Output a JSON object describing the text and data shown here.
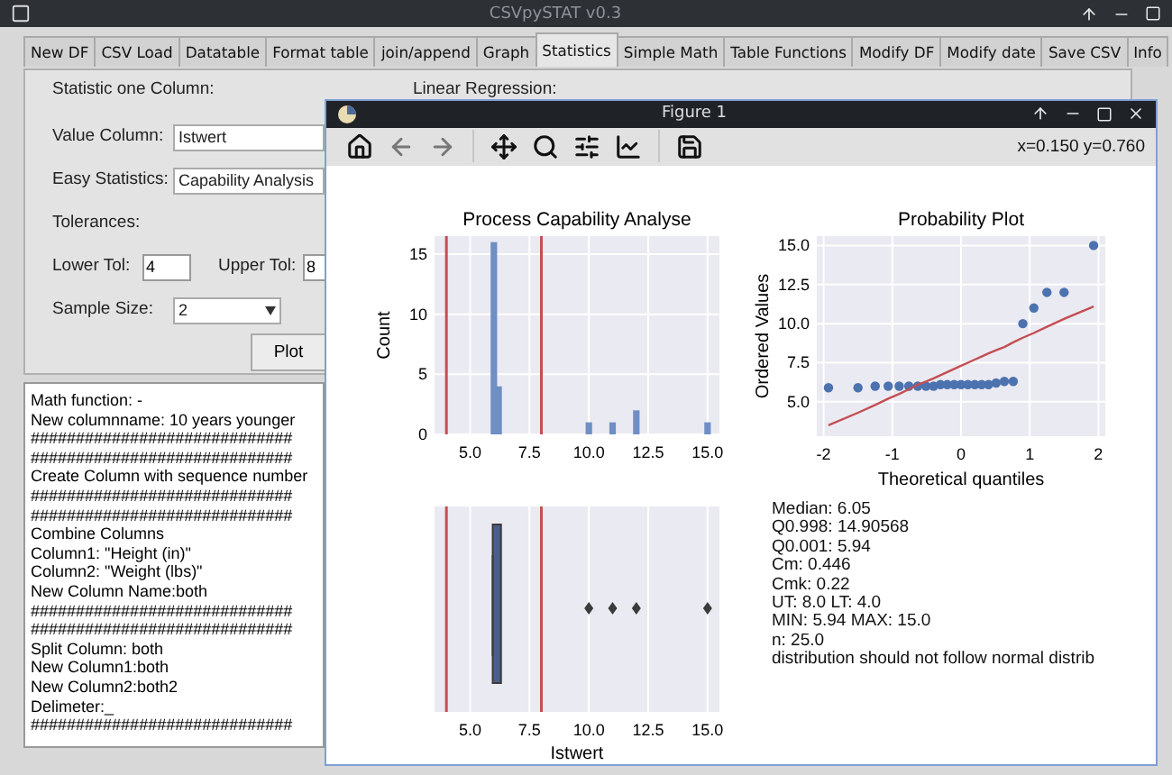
{
  "window": {
    "title": "CSVpySTAT v0.3"
  },
  "tabs": [
    {
      "label": "New DF",
      "selected": false
    },
    {
      "label": "CSV Load",
      "selected": false
    },
    {
      "label": "Datatable",
      "selected": false
    },
    {
      "label": "Format table",
      "selected": false
    },
    {
      "label": "join/append",
      "selected": false
    },
    {
      "label": "Graph",
      "selected": false
    },
    {
      "label": "Statistics",
      "selected": true
    },
    {
      "label": "Simple Math",
      "selected": false
    },
    {
      "label": "Table Functions",
      "selected": false
    },
    {
      "label": "Modify DF",
      "selected": false
    },
    {
      "label": "Modify date",
      "selected": false
    },
    {
      "label": "Save CSV",
      "selected": false
    },
    {
      "label": "Info",
      "selected": false
    }
  ],
  "form": {
    "heading": "Statistic one Column:",
    "regression_heading": "Linear Regression:",
    "value_column": {
      "label": "Value Column:",
      "value": "Istwert"
    },
    "easy_statistics": {
      "label": "Easy Statistics:",
      "value": "Capability Analysis"
    },
    "tolerances_label": "Tolerances:",
    "lower_tol": {
      "label": "Lower Tol:",
      "value": "4"
    },
    "upper_tol": {
      "label": "Upper Tol:",
      "value": "8"
    },
    "sample_size": {
      "label": "Sample Size:",
      "value": "2"
    },
    "plot_button": "Plot"
  },
  "log": {
    "lines": [
      "Math function: -",
      "New columnname: 10 years younger",
      "#############################",
      "#############################",
      "Create Column with sequence number",
      "#############################",
      "#############################",
      "Combine Columns",
      "Column1: \"Height (in)\"",
      "Column2: \"Weight (lbs)\"",
      "New Column Name:both",
      "#############################",
      "#############################",
      "Split Column: both",
      "New Column1:both",
      "New Column2:both2",
      "Delimeter:_",
      "#############################"
    ]
  },
  "figure": {
    "title": "Figure 1",
    "coordinates": "x=0.150 y=0.760",
    "histogram": {
      "title": "Process Capability Analyse",
      "chart_data": {
        "type": "bar",
        "ylabel": "Count",
        "x": [
          6.0,
          6.2,
          10,
          11,
          12,
          15
        ],
        "values": [
          16,
          4,
          1,
          1,
          2,
          1
        ],
        "xlim": [
          3.5,
          15.5
        ],
        "ylim": [
          0,
          16.5
        ],
        "xticks": [
          {
            "value": 5,
            "label": "5.0"
          },
          {
            "value": 7.5,
            "label": "7.5"
          },
          {
            "value": 10,
            "label": "10.0"
          },
          {
            "value": 12.5,
            "label": "12.5"
          },
          {
            "value": 15,
            "label": "15.0"
          }
        ],
        "yticks": [
          0,
          5,
          10,
          15
        ],
        "grid": true,
        "ref_lines": [
          {
            "axis": "x",
            "value": 4
          },
          {
            "axis": "x",
            "value": 8
          }
        ]
      }
    },
    "probability_plot": {
      "title": "Probability Plot",
      "chart_data": {
        "type": "scatter",
        "xlabel": "Theoretical quantiles",
        "ylabel": "Ordered Values",
        "x": [
          -1.93,
          -1.5,
          -1.25,
          -1.06,
          -0.9,
          -0.76,
          -0.63,
          -0.51,
          -0.4,
          -0.3,
          -0.2,
          -0.1,
          0,
          0.1,
          0.2,
          0.3,
          0.4,
          0.51,
          0.63,
          0.76,
          0.9,
          1.06,
          1.25,
          1.5,
          1.93
        ],
        "series": [
          {
            "type": "scatter",
            "color": "#4c72b0",
            "values": [
              5.9,
              5.9,
              6.0,
              6.0,
              6.0,
              6.0,
              6.0,
              6.0,
              6.0,
              6.1,
              6.1,
              6.1,
              6.1,
              6.1,
              6.1,
              6.1,
              6.1,
              6.2,
              6.3,
              6.3,
              10,
              11,
              12,
              12,
              15
            ]
          },
          {
            "type": "line",
            "color": "#c44e52",
            "values": [
              3.5,
              4.3,
              4.8,
              5.2,
              5.5,
              5.8,
              6.1,
              6.3,
              6.5,
              6.7,
              6.9,
              7.1,
              7.3,
              7.5,
              7.7,
              7.9,
              8.1,
              8.3,
              8.5,
              8.8,
              9.1,
              9.4,
              9.8,
              10.3,
              11.1
            ]
          }
        ],
        "xlim": [
          -2.1,
          2.1
        ],
        "ylim": [
          2.8,
          15.6
        ],
        "xticks": [
          -2,
          -1,
          0,
          1,
          2
        ],
        "grid": true,
        "yticks": [
          {
            "value": 5,
            "label": "5.0"
          },
          {
            "value": 7.5,
            "label": "7.5"
          },
          {
            "value": 10,
            "label": "10.0"
          },
          {
            "value": 12.5,
            "label": "12.5"
          },
          {
            "value": 15,
            "label": "15.0"
          }
        ]
      }
    },
    "boxplot": {
      "ticks": [
        "5.0",
        "7.5",
        "10.0",
        "12.5",
        "15.0"
      ],
      "xlabel": "Istwert"
    },
    "stats": [
      "Median: 6.05",
      "Q0.998: 14.90568",
      "Q0.001: 5.94",
      "Cm: 0.446",
      "Cmk: 0.22",
      "UT: 8.0 LT: 4.0",
      "MIN: 5.94 MAX: 15.0",
      "n: 25.0",
      "distribution should not follow normal distrib"
    ]
  }
}
